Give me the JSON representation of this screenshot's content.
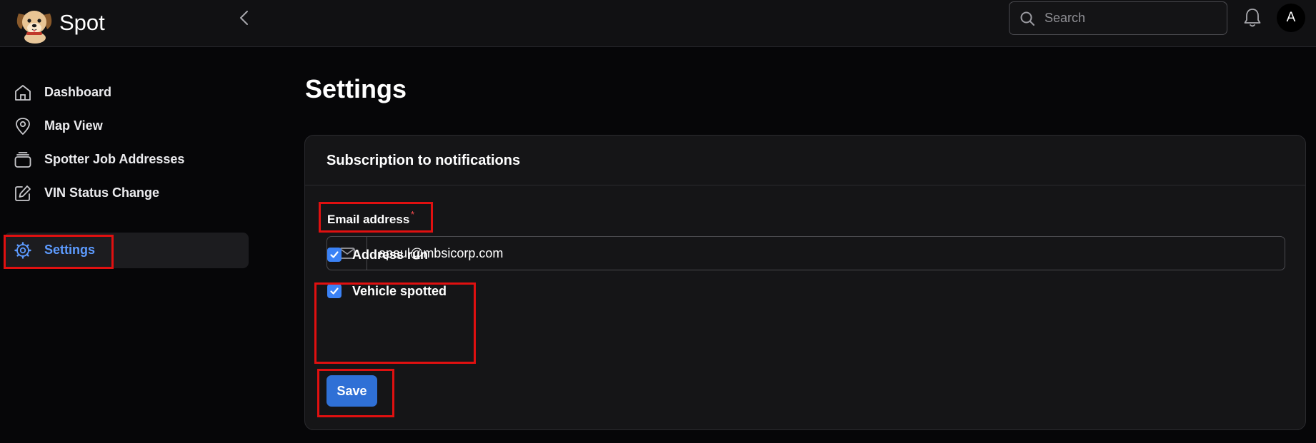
{
  "app": {
    "brand": "Spot"
  },
  "header": {
    "search_placeholder": "Search",
    "avatar_initial": "A"
  },
  "sidebar": {
    "items": [
      {
        "label": "Dashboard",
        "icon": "home-icon",
        "active": false
      },
      {
        "label": "Map View",
        "icon": "map-pin-icon",
        "active": false
      },
      {
        "label": "Spotter Job Addresses",
        "icon": "layers-icon",
        "active": false
      },
      {
        "label": "VIN Status Change",
        "icon": "edit-icon",
        "active": false
      },
      {
        "label": "Settings",
        "icon": "gear-icon",
        "active": true
      }
    ]
  },
  "page": {
    "title": "Settings"
  },
  "card": {
    "title": "Subscription to notifications",
    "email_label": "Email address",
    "required_mark": "*",
    "email_value": "apaul@mbsicorp.com",
    "checkboxes": [
      {
        "label": "Address run",
        "checked": true
      },
      {
        "label": "Vehicle spotted",
        "checked": true
      }
    ],
    "save_label": "Save"
  },
  "colors": {
    "accent": "#2f70d6",
    "checkbox": "#3b82f6",
    "active_nav_text": "#5d9bff",
    "required": "#ff4d4f",
    "highlight": "#e01010",
    "background": "#060608",
    "panel": "#151517"
  }
}
